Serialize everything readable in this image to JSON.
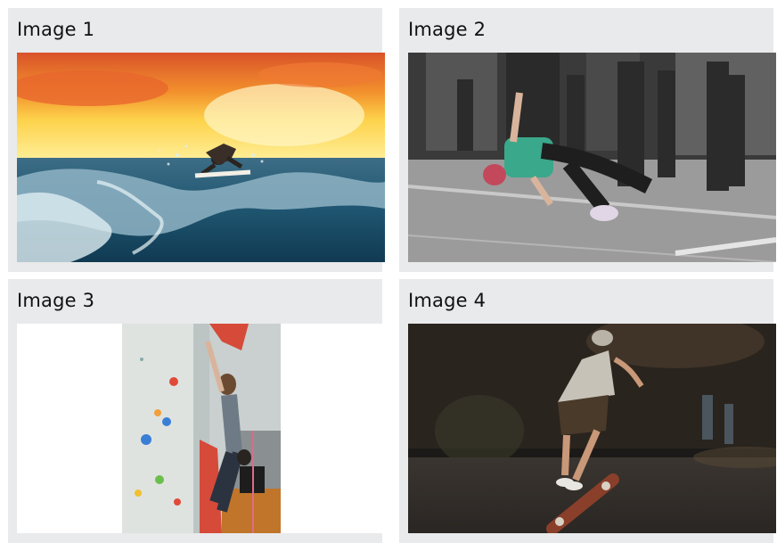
{
  "gallery": {
    "cards": [
      {
        "title": "Image 1",
        "image_icon": "surfer-photo"
      },
      {
        "title": "Image 2",
        "image_icon": "breakdancer-photo"
      },
      {
        "title": "Image 3",
        "image_icon": "climber-photo"
      },
      {
        "title": "Image 4",
        "image_icon": "skateboarder-photo"
      }
    ]
  },
  "colors": {
    "card_background": "#e9eaeb",
    "title_text": "#111111"
  }
}
